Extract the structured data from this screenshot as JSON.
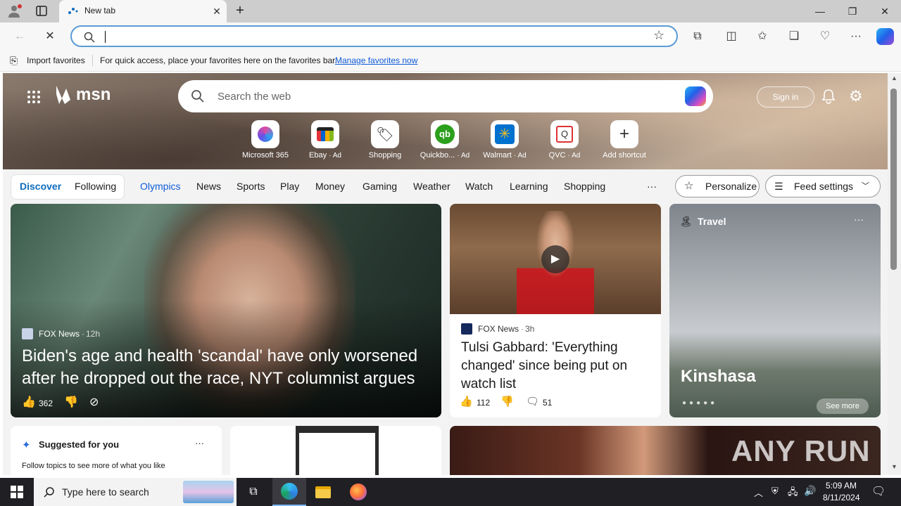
{
  "browser": {
    "tab_title": "New tab",
    "address_value": "",
    "favorites_bar": {
      "import_label": "Import favorites",
      "message": "For quick access, place your favorites here on the favorites bar.",
      "manage_link": "Manage favorites now"
    }
  },
  "msn": {
    "logo_text": "msn",
    "search_placeholder": "Search the web",
    "signin_label": "Sign in",
    "quick_links": [
      {
        "label": "Microsoft 365",
        "ad": ""
      },
      {
        "label": "Ebay",
        "ad": "· Ad"
      },
      {
        "label": "Shopping",
        "ad": ""
      },
      {
        "label": "Quickbo...",
        "ad": "· Ad"
      },
      {
        "label": "Walmart",
        "ad": "· Ad"
      },
      {
        "label": "QVC",
        "ad": "· Ad"
      },
      {
        "label": "Add shortcut",
        "ad": ""
      }
    ],
    "nav": {
      "discover": "Discover",
      "following": "Following",
      "items": [
        "Olympics",
        "News",
        "Sports",
        "Play",
        "Money",
        "Gaming",
        "Weather",
        "Watch",
        "Learning",
        "Shopping"
      ],
      "more": "···",
      "personalize": "Personalize",
      "feed_settings": "Feed settings"
    },
    "cards": {
      "main": {
        "source": "FOX News",
        "age": "12h",
        "headline": "Biden's age and health 'scandal' have only worsened after he dropped out the race, NYT columnist argues",
        "likes": "362"
      },
      "tulsi": {
        "source": "FOX News",
        "age": "3h",
        "headline": "Tulsi Gabbard: 'Everything changed' since being put on watch list",
        "likes": "112",
        "comments": "51"
      },
      "travel": {
        "category": "Travel",
        "title": "Kinshasa",
        "see_more": "See more"
      },
      "suggested": {
        "title": "Suggested for you",
        "subtitle": "Follow topics to see more of what you like",
        "more": "···"
      }
    },
    "watermark": "ANY RUN"
  },
  "taskbar": {
    "search_placeholder": "Type here to search",
    "time": "5:09 AM",
    "date": "8/11/2024"
  },
  "colors": {
    "accent_blue": "#0f6cbd",
    "msn_link_blue": "#0f5bd8",
    "taskbar": "#1f1f24"
  }
}
